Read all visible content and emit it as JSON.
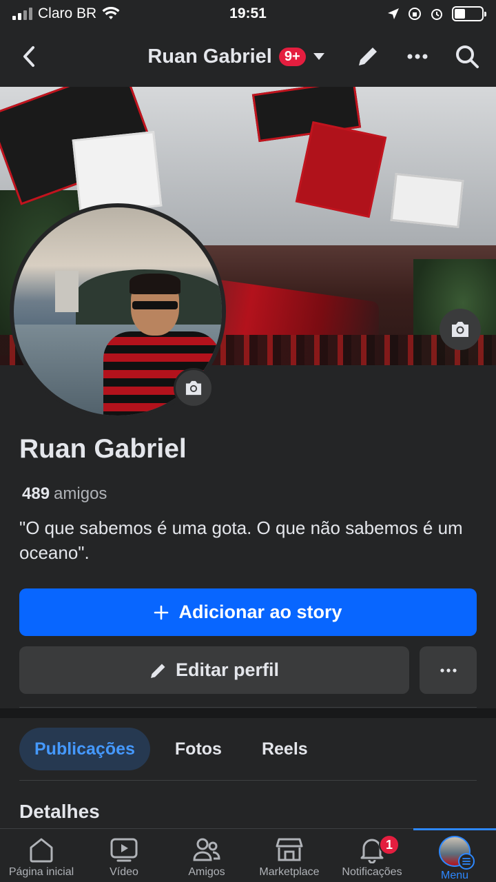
{
  "status_bar": {
    "carrier": "Claro BR",
    "time": "19:51",
    "battery_level": 0.4
  },
  "header": {
    "title": "Ruan Gabriel",
    "badge": "9+"
  },
  "profile": {
    "name": "Ruan Gabriel",
    "friends_count": "489",
    "friends_label": "amigos",
    "bio": "\"O que sabemos é uma gota. O que não sabemos é um oceano\"."
  },
  "buttons": {
    "add_story": "Adicionar ao story",
    "edit_profile": "Editar perfil"
  },
  "tabs": [
    {
      "label": "Publicações",
      "active": true
    },
    {
      "label": "Fotos",
      "active": false
    },
    {
      "label": "Reels",
      "active": false
    }
  ],
  "details_heading": "Detalhes",
  "bottom_nav": [
    {
      "label": "Página inicial",
      "icon": "home-icon"
    },
    {
      "label": "Vídeo",
      "icon": "video-icon"
    },
    {
      "label": "Amigos",
      "icon": "friends-icon"
    },
    {
      "label": "Marketplace",
      "icon": "marketplace-icon"
    },
    {
      "label": "Notificações",
      "icon": "bell-icon",
      "badge": "1"
    },
    {
      "label": "Menu",
      "icon": "menu-avatar",
      "active": true
    }
  ],
  "colors": {
    "primary": "#0866ff",
    "background": "#242526",
    "badge": "#e41e3f",
    "active_tab_bg": "#263951",
    "active_tab_text": "#4599ff"
  }
}
